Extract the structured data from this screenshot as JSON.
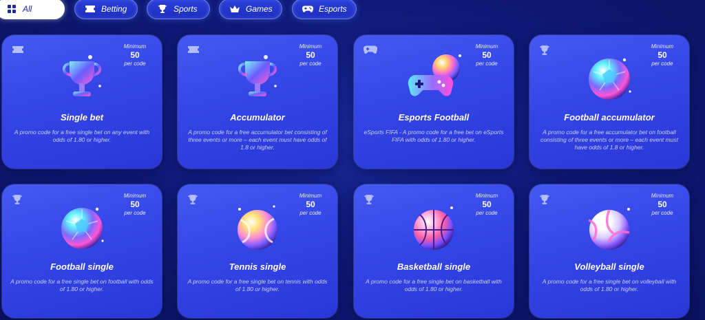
{
  "filters": [
    {
      "label": "All",
      "icon": "grid-icon",
      "active": true
    },
    {
      "label": "Betting",
      "icon": "ticket-icon",
      "active": false
    },
    {
      "label": "Sports",
      "icon": "trophy-icon",
      "active": false
    },
    {
      "label": "Games",
      "icon": "crown-icon",
      "active": false
    },
    {
      "label": "Esports",
      "icon": "gamepad-icon",
      "active": false
    }
  ],
  "cards": [
    {
      "title": "Single bet",
      "min_label": "Minimum",
      "min_value": "50",
      "min_unit": "per code",
      "description": "A promo code for a free single bet on any event with odds of 1.80 or higher.",
      "corner_icon": "ticket-icon",
      "art": "trophy-art"
    },
    {
      "title": "Accumulator",
      "min_label": "Minimum",
      "min_value": "50",
      "min_unit": "per code",
      "description": "A promo code for a free accumulator bet consisting of three events or more – each event must have odds of 1.8 or higher.",
      "corner_icon": "ticket-icon",
      "art": "trophy-art"
    },
    {
      "title": "Esports Football",
      "min_label": "Minimum",
      "min_value": "50",
      "min_unit": "per code",
      "description": "eSports FIFA - A promo code for a free bet on eSports FIFA with odds of 1.80 or higher.",
      "corner_icon": "gamepad-icon",
      "art": "gamepad-ball-art"
    },
    {
      "title": "Football accumulator",
      "min_label": "Minimum",
      "min_value": "50",
      "min_unit": "per code",
      "description": "A promo code for a free accumulator bet on football consisting of three events or more – each event must have odds of 1.8 or higher.",
      "corner_icon": "trophy-icon",
      "art": "football-art"
    },
    {
      "title": "Football single",
      "min_label": "Minimum",
      "min_value": "50",
      "min_unit": "per code",
      "description": "A promo code for a free single bet on football with odds of 1.80 or higher.",
      "corner_icon": "trophy-icon",
      "art": "football-art"
    },
    {
      "title": "Tennis single",
      "min_label": "Minimum",
      "min_value": "50",
      "min_unit": "per code",
      "description": "A promo code for a free single bet on tennis with odds of 1.80 or higher.",
      "corner_icon": "trophy-icon",
      "art": "tennis-art"
    },
    {
      "title": "Basketball single",
      "min_label": "Minimum",
      "min_value": "50",
      "min_unit": "per code",
      "description": "A promo code for a free single bet on basketball with odds of 1.80 or higher.",
      "corner_icon": "trophy-icon",
      "art": "basketball-art"
    },
    {
      "title": "Volleyball single",
      "min_label": "Minimum",
      "min_value": "50",
      "min_unit": "per code",
      "description": "A promo code for a free single bet on volleyball with odds of 1.80 or higher.",
      "corner_icon": "trophy-icon",
      "art": "volleyball-art"
    }
  ],
  "colors": {
    "background": "#0f1a78",
    "card": "#3445e6",
    "chip": "#2133c8",
    "accent_pink": "#ff4fd8",
    "accent_cyan": "#36e6ff"
  }
}
